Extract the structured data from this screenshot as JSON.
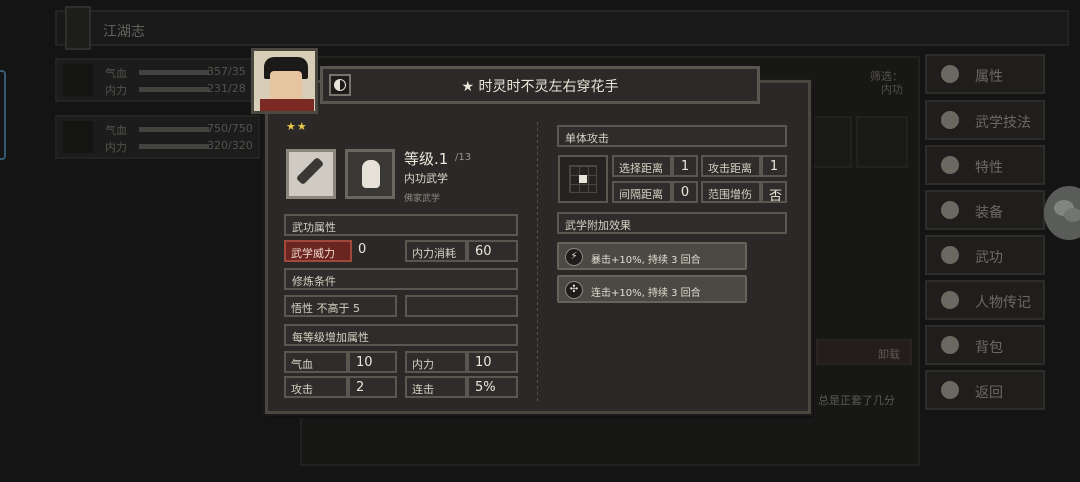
{
  "background": {
    "top_title": "江湖志",
    "characters": [
      {
        "hp_label": "气血",
        "hp_value": "357/35",
        "mp_label": "内力",
        "mp_value": "231/28"
      },
      {
        "hp_label": "气血",
        "hp_value": "750/750",
        "mp_label": "内力",
        "mp_value": "320/320"
      }
    ],
    "filter": {
      "label": "筛选：",
      "value": "内功"
    },
    "unequip_label": "卸载",
    "hint_text": "总是正套了几分"
  },
  "side_menu": [
    {
      "label": "属性",
      "icon": "person-icon"
    },
    {
      "label": "武学技法",
      "icon": "martial-arts-icon"
    },
    {
      "label": "特性",
      "icon": "trait-icon"
    },
    {
      "label": "装备",
      "icon": "sword-icon"
    },
    {
      "label": "武功",
      "icon": "manual-icon"
    },
    {
      "label": "人物传记",
      "icon": "biography-icon"
    },
    {
      "label": "背包",
      "icon": "bag-icon"
    },
    {
      "label": "返回",
      "icon": "return-icon"
    }
  ],
  "dialog": {
    "title": "★ 时灵时不灵左右穿花手",
    "stars": "★★",
    "level_label": "等级.1",
    "level_max": "/13",
    "type_label": "内功武学",
    "sub_type": "佛家武学",
    "sections": {
      "attributes": "武功属性",
      "requirements": "修炼条件",
      "per_level": "每等级增加属性",
      "single_attack": "单体攻击",
      "extra_effects": "武学附加效果"
    },
    "attributes": {
      "power_label": "武学威力",
      "power_value": "0",
      "cost_label": "内力消耗",
      "cost_value": "60"
    },
    "requirements": {
      "req1": "悟性 不高于 5",
      "req2": ""
    },
    "per_level": {
      "hp_label": "气血",
      "hp_value": "10",
      "mp_label": "内力",
      "mp_value": "10",
      "atk_label": "攻击",
      "atk_value": "2",
      "combo_label": "连击",
      "combo_value": "5%"
    },
    "range": {
      "select_label": "选择距离",
      "select_value": "1",
      "attack_label": "攻击距离",
      "attack_value": "1",
      "gap_label": "间隔距离",
      "gap_value": "0",
      "aoe_label": "范围增伤",
      "aoe_value": "否"
    },
    "effects": [
      {
        "icon": "lightning-icon",
        "text": "暴击+10%, 持续 3 回合"
      },
      {
        "icon": "combo-icon",
        "text": "连击+10%, 持续 3 回合"
      }
    ]
  }
}
